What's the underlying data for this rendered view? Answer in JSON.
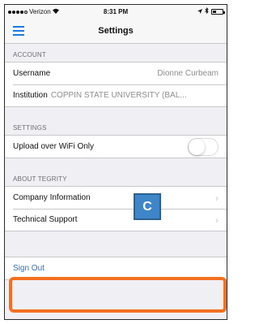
{
  "status_bar": {
    "carrier": "Verizon",
    "time": "8:31 PM"
  },
  "nav": {
    "title": "Settings"
  },
  "sections": {
    "account": {
      "header": "ACCOUNT",
      "username_label": "Username",
      "username_value": "Dionne Curbeam",
      "institution_label": "Institution",
      "institution_value": "COPPIN STATE UNIVERSITY (BAL..."
    },
    "settings": {
      "header": "SETTINGS",
      "wifi_label": "Upload over WiFi Only",
      "wifi_enabled": false
    },
    "about": {
      "header": "ABOUT TEGRITY",
      "company_label": "Company Information",
      "support_label": "Technical Support"
    }
  },
  "sign_out": {
    "label": "Sign Out"
  },
  "annotation": {
    "badge_letter": "C",
    "badge_color": "#3f86c9",
    "highlight_color": "#f37021"
  },
  "colors": {
    "link_blue": "#1f6fd6",
    "background": "#efeff4"
  }
}
